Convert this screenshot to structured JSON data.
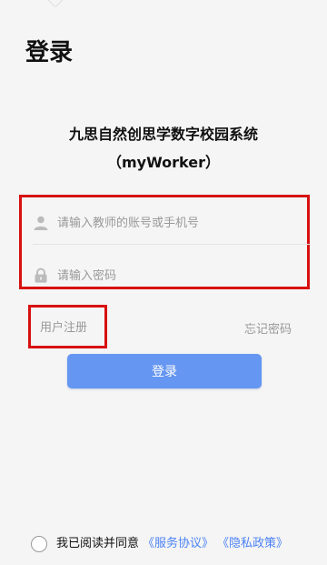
{
  "page": {
    "title": "登录"
  },
  "app": {
    "name": "九思自然创思学数字校园系统",
    "subname": "（myWorker）"
  },
  "form": {
    "username_placeholder": "请输入教师的账号或手机号",
    "password_placeholder": "请输入密码",
    "register_label": "用户注册",
    "forgot_label": "忘记密码",
    "login_label": "登录"
  },
  "agreement": {
    "text": "我已阅读并同意",
    "service_link": "《服务协议》",
    "privacy_link": "《隐私政策》"
  },
  "icons": {
    "user": "user-icon",
    "lock": "lock-icon",
    "checkbox": "agree-checkbox"
  },
  "colors": {
    "background": "#f5f5f5",
    "primary": "#6596f2",
    "link": "#4c82f5",
    "highlight": "#d81010",
    "muted": "#999999"
  }
}
